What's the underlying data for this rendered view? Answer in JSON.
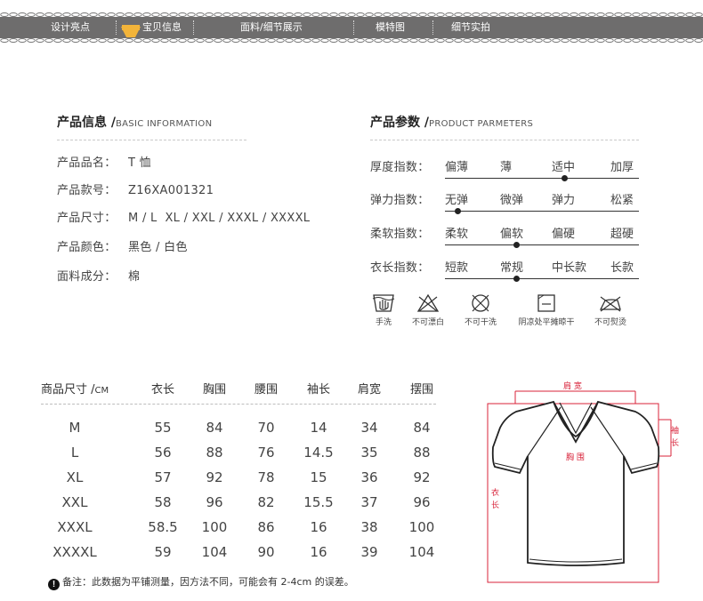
{
  "nav": {
    "items": [
      "设计亮点",
      "宝贝信息",
      "面料/细节展示",
      "模特图",
      "细节实拍"
    ],
    "active_index": 1,
    "bar_color": "#6e6d6d",
    "marker_color": "#f2b43a"
  },
  "info": {
    "title": "产品信息 /",
    "subtitle": "BASIC INFORMATION",
    "rows": [
      {
        "label": "产品品名：",
        "value": "T 恤"
      },
      {
        "label": "产品款号：",
        "value": "Z16XA001321"
      },
      {
        "label": "产品尺寸：",
        "value": "M / L  XL / XXL / XXXL / XXXXL"
      },
      {
        "label": "产品颜色：",
        "value": "黑色 / 白色"
      },
      {
        "label": "面料成分：",
        "value": "棉"
      }
    ]
  },
  "params": {
    "title": "产品参数 /",
    "subtitle": "PRODUCT PARMETERS",
    "rows": [
      {
        "label": "厚度指数：",
        "options": [
          "偏薄",
          "薄",
          "适中",
          "加厚"
        ],
        "selected_index": 2
      },
      {
        "label": "弹力指数：",
        "options": [
          "无弹",
          "微弹",
          "弹力",
          "松紧"
        ],
        "selected_index": 0
      },
      {
        "label": "柔软指数：",
        "options": [
          "柔软",
          "偏软",
          "偏硬",
          "超硬"
        ],
        "selected_index": 1
      },
      {
        "label": "衣长指数：",
        "options": [
          "短款",
          "常规",
          "中长款",
          "长款"
        ],
        "selected_index": 1
      }
    ]
  },
  "care": [
    {
      "icon": "hand-wash-icon",
      "label": "手洗"
    },
    {
      "icon": "no-bleach-icon",
      "label": "不可漂白"
    },
    {
      "icon": "no-dry-clean-icon",
      "label": "不可干洗"
    },
    {
      "icon": "shade-flat-dry-icon",
      "label": "阴凉处平摊晾干"
    },
    {
      "icon": "no-iron-icon",
      "label": "不可熨烫"
    }
  ],
  "size_table": {
    "header_label": "商品尺寸 /",
    "header_unit": "CM",
    "columns": [
      "衣长",
      "胸围",
      "腰围",
      "袖长",
      "肩宽",
      "摆围"
    ],
    "rows": [
      {
        "size": "M",
        "values": [
          "55",
          "84",
          "70",
          "14",
          "34",
          "84"
        ]
      },
      {
        "size": "L",
        "values": [
          "56",
          "88",
          "76",
          "14.5",
          "35",
          "88"
        ]
      },
      {
        "size": "XL",
        "values": [
          "57",
          "92",
          "78",
          "15",
          "36",
          "92"
        ]
      },
      {
        "size": "XXL",
        "values": [
          "58",
          "96",
          "82",
          "15.5",
          "37",
          "96"
        ]
      },
      {
        "size": "XXXL",
        "values": [
          "58.5",
          "100",
          "86",
          "16",
          "38",
          "100"
        ]
      },
      {
        "size": "XXXXL",
        "values": [
          "59",
          "104",
          "90",
          "16",
          "39",
          "104"
        ]
      }
    ],
    "note_icon": "!",
    "note": "备注：此数据为平铺测量，因方法不同，可能会有 2-4cm 的误差。"
  },
  "diagram": {
    "shoulder_label": "肩 宽",
    "chest_label": "胸 围",
    "sleeve_label": [
      "袖",
      "长"
    ],
    "length_label": [
      "衣",
      "长"
    ],
    "accent_color": "#d8233a"
  }
}
